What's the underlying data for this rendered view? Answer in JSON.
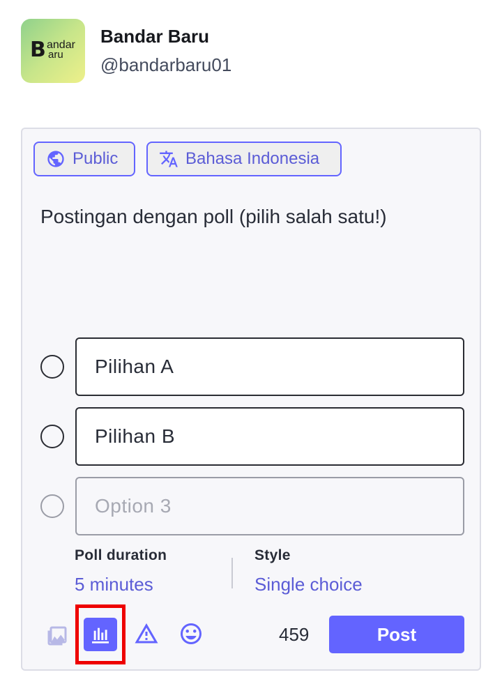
{
  "account": {
    "display_name": "Bandar Baru",
    "handle": "@bandarbaru01",
    "avatar_text": {
      "big": "B",
      "line1": "andar",
      "line2": "aru"
    }
  },
  "composer": {
    "visibility_label": "Public",
    "language_label": "Bahasa Indonesia",
    "status_text": "Postingan dengan poll (pilih salah satu!)",
    "poll": {
      "options": [
        {
          "value": "Pilihan A",
          "placeholder": ""
        },
        {
          "value": "Pilihan B",
          "placeholder": ""
        },
        {
          "value": "",
          "placeholder": "Option 3"
        }
      ],
      "duration_label": "Poll duration",
      "duration_value": "5 minutes",
      "style_label": "Style",
      "style_value": "Single choice"
    },
    "toolbar": {
      "icons": [
        "image-icon",
        "poll-icon",
        "warning-icon",
        "emoji-icon"
      ],
      "char_count": "459",
      "post_label": "Post"
    }
  },
  "colors": {
    "accent": "#6364ff",
    "link": "#5b5cd6",
    "highlight": "#ee0000"
  }
}
